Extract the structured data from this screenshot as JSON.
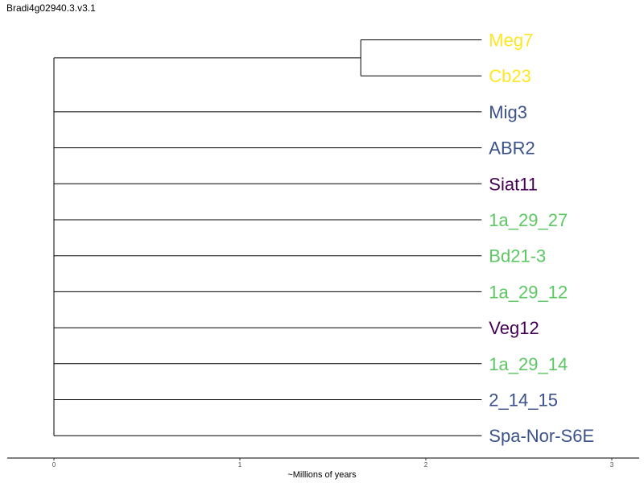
{
  "title": "Bradi4g02940.3.v3.1",
  "axis": {
    "label": "~Millions of years",
    "ticks": [
      "0",
      "1",
      "2",
      "3"
    ]
  },
  "colors": {
    "yellow": "#FDE725",
    "blue": "#3B528B",
    "purple": "#440154",
    "green": "#5DC863",
    "line": "#000000"
  },
  "tips": [
    {
      "label": "Meg7",
      "color": "#FDE725"
    },
    {
      "label": "Cb23",
      "color": "#FDE725"
    },
    {
      "label": "Mig3",
      "color": "#3B528B"
    },
    {
      "label": "ABR2",
      "color": "#3B528B"
    },
    {
      "label": "Siat11",
      "color": "#440154"
    },
    {
      "label": "1a_29_27",
      "color": "#5DC863"
    },
    {
      "label": "Bd21-3",
      "color": "#5DC863"
    },
    {
      "label": "1a_29_12",
      "color": "#5DC863"
    },
    {
      "label": "Veg12",
      "color": "#440154"
    },
    {
      "label": "1a_29_14",
      "color": "#5DC863"
    },
    {
      "label": "2_14_15",
      "color": "#3B528B"
    },
    {
      "label": "Spa-Nor-S6E",
      "color": "#3B528B"
    }
  ],
  "tree": {
    "root_age": 0,
    "tip_age": 2.3,
    "clade_age": 1.65,
    "clade_tips": [
      0,
      1
    ]
  }
}
